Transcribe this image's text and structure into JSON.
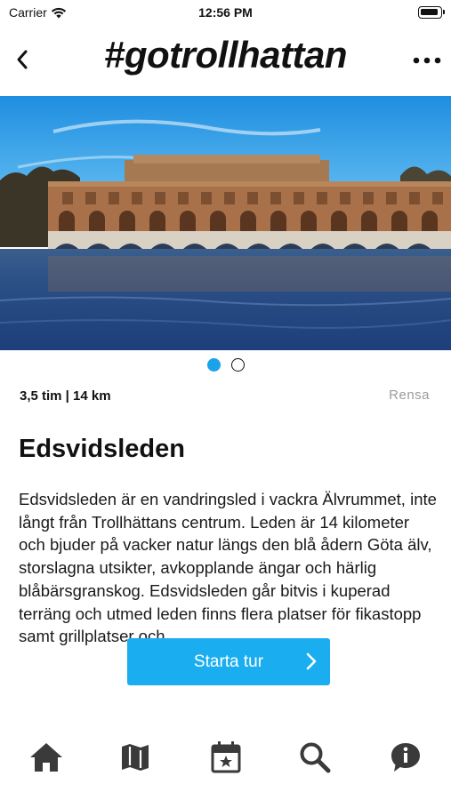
{
  "status_bar": {
    "carrier": "Carrier",
    "time": "12:56 PM",
    "icons": [
      "wifi-icon",
      "battery-icon"
    ]
  },
  "header": {
    "title": "#gotrollhattan",
    "back_icon": "chevron-left-icon",
    "more_icon": "more-dots-icon"
  },
  "hero": {
    "image": "river-power-station-photo",
    "pages": 2,
    "active_page": 1
  },
  "trail": {
    "meta": "3,5 tim | 14 km",
    "clear_label": "Rensa",
    "title": "Edsvidsleden",
    "description": "Edsvidsleden är en vandringsled i vackra Älvrummet, inte långt från Trollhättans centrum. Leden är 14 kilometer och bjuder på vacker natur längs den blå ådern Göta älv, storslagna utsikter, avkopplande ängar och härlig blåbärsgranskog. Edsvidsleden går bitvis i kuperad terräng och utmed leden finns flera platser för fikastopp samt grillplatser och"
  },
  "action": {
    "start_label": "Starta tur",
    "icon": "chevron-right-icon"
  },
  "tab_bar": {
    "items": [
      {
        "icon": "home-icon"
      },
      {
        "icon": "map-icon"
      },
      {
        "icon": "calendar-star-icon"
      },
      {
        "icon": "search-icon"
      },
      {
        "icon": "info-icon"
      }
    ]
  },
  "colors": {
    "accent": "#1aaef0",
    "dot_active": "#1aa3e8",
    "tab_icon": "#3a3a3a",
    "muted_text": "#9b9b9b"
  }
}
